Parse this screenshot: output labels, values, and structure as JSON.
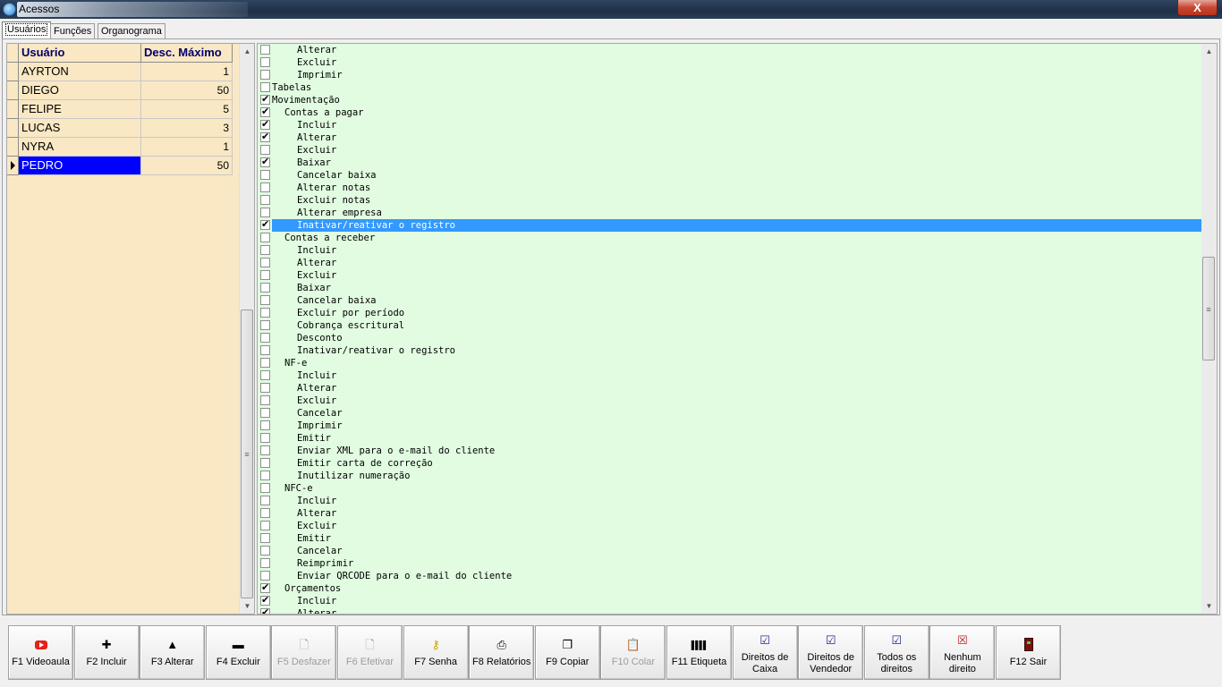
{
  "window": {
    "title": "Acessos",
    "close_glyph": "X"
  },
  "tabs": [
    {
      "label": "Usuários",
      "active": true
    },
    {
      "label": "Funções",
      "active": false
    },
    {
      "label": "Organograma",
      "active": false
    }
  ],
  "users_grid": {
    "columns": [
      "Usuário",
      "Desc. Máximo"
    ],
    "rows": [
      {
        "name": "AYRTON",
        "desc_max": "1"
      },
      {
        "name": "DIEGO",
        "desc_max": "50"
      },
      {
        "name": "FELIPE",
        "desc_max": "5"
      },
      {
        "name": "LUCAS",
        "desc_max": "3"
      },
      {
        "name": "NYRA",
        "desc_max": "1"
      },
      {
        "name": "PEDRO",
        "desc_max": "50",
        "selected": true
      }
    ]
  },
  "permissions": [
    {
      "label": "Alterar",
      "level": 2,
      "checked": false
    },
    {
      "label": "Excluir",
      "level": 2,
      "checked": false
    },
    {
      "label": "Imprimir",
      "level": 2,
      "checked": false
    },
    {
      "label": "Tabelas",
      "level": 0,
      "checked": false
    },
    {
      "label": "Movimentação",
      "level": 0,
      "checked": true
    },
    {
      "label": "Contas a pagar",
      "level": 1,
      "checked": true
    },
    {
      "label": "Incluir",
      "level": 2,
      "checked": true
    },
    {
      "label": "Alterar",
      "level": 2,
      "checked": true
    },
    {
      "label": "Excluir",
      "level": 2,
      "checked": false
    },
    {
      "label": "Baixar",
      "level": 2,
      "checked": true
    },
    {
      "label": "Cancelar baixa",
      "level": 2,
      "checked": false
    },
    {
      "label": "Alterar notas",
      "level": 2,
      "checked": false
    },
    {
      "label": "Excluir notas",
      "level": 2,
      "checked": false
    },
    {
      "label": "Alterar empresa",
      "level": 2,
      "checked": false
    },
    {
      "label": "Inativar/reativar o registro",
      "level": 2,
      "checked": true,
      "selected": true
    },
    {
      "label": "Contas a receber",
      "level": 1,
      "checked": false
    },
    {
      "label": "Incluir",
      "level": 2,
      "checked": false
    },
    {
      "label": "Alterar",
      "level": 2,
      "checked": false
    },
    {
      "label": "Excluir",
      "level": 2,
      "checked": false
    },
    {
      "label": "Baixar",
      "level": 2,
      "checked": false
    },
    {
      "label": "Cancelar baixa",
      "level": 2,
      "checked": false
    },
    {
      "label": "Excluir por período",
      "level": 2,
      "checked": false
    },
    {
      "label": "Cobrança escritural",
      "level": 2,
      "checked": false
    },
    {
      "label": "Desconto",
      "level": 2,
      "checked": false
    },
    {
      "label": "Inativar/reativar o registro",
      "level": 2,
      "checked": false
    },
    {
      "label": "NF-e",
      "level": 1,
      "checked": false
    },
    {
      "label": "Incluir",
      "level": 2,
      "checked": false
    },
    {
      "label": "Alterar",
      "level": 2,
      "checked": false
    },
    {
      "label": "Excluir",
      "level": 2,
      "checked": false
    },
    {
      "label": "Cancelar",
      "level": 2,
      "checked": false
    },
    {
      "label": "Imprimir",
      "level": 2,
      "checked": false
    },
    {
      "label": "Emitir",
      "level": 2,
      "checked": false
    },
    {
      "label": "Enviar XML para o e-mail do cliente",
      "level": 2,
      "checked": false
    },
    {
      "label": "Emitir carta de correção",
      "level": 2,
      "checked": false
    },
    {
      "label": "Inutilizar numeração",
      "level": 2,
      "checked": false
    },
    {
      "label": "NFC-e",
      "level": 1,
      "checked": false
    },
    {
      "label": "Incluir",
      "level": 2,
      "checked": false
    },
    {
      "label": "Alterar",
      "level": 2,
      "checked": false
    },
    {
      "label": "Excluir",
      "level": 2,
      "checked": false
    },
    {
      "label": "Emitir",
      "level": 2,
      "checked": false
    },
    {
      "label": "Cancelar",
      "level": 2,
      "checked": false
    },
    {
      "label": "Reimprimir",
      "level": 2,
      "checked": false
    },
    {
      "label": "Enviar QRCODE para o e-mail do cliente",
      "level": 2,
      "checked": false
    },
    {
      "label": "Orçamentos",
      "level": 1,
      "checked": true
    },
    {
      "label": "Incluir",
      "level": 2,
      "checked": true
    },
    {
      "label": "Alterar",
      "level": 2,
      "checked": true
    }
  ],
  "toolbar": [
    {
      "name": "videoaula",
      "label": "F1 Videoaula",
      "icon": "youtube-icon",
      "enabled": true
    },
    {
      "name": "incluir",
      "label": "F2 Incluir",
      "icon": "plus-icon",
      "glyph": "✚",
      "enabled": true
    },
    {
      "name": "alterar",
      "label": "F3 Alterar",
      "icon": "triangle-up-icon",
      "glyph": "▲",
      "enabled": true
    },
    {
      "name": "excluir",
      "label": "F4 Excluir",
      "icon": "minus-icon",
      "glyph": "▬",
      "enabled": true
    },
    {
      "name": "desfazer",
      "label": "F5 Desfazer",
      "icon": "page-icon",
      "glyph": "🗋",
      "enabled": false
    },
    {
      "name": "efetivar",
      "label": "F6 Efetivar",
      "icon": "page-icon",
      "glyph": "🗋",
      "enabled": false
    },
    {
      "name": "senha",
      "label": "F7 Senha",
      "icon": "key-icon",
      "glyph": "⚷",
      "enabled": true
    },
    {
      "name": "relatorios",
      "label": "F8 Relatórios",
      "icon": "printer-icon",
      "glyph": "⎙",
      "enabled": true
    },
    {
      "name": "copiar",
      "label": "F9 Copiar",
      "icon": "copy-icon",
      "glyph": "❐",
      "enabled": true
    },
    {
      "name": "colar",
      "label": "F10 Colar",
      "icon": "paste-icon",
      "glyph": "📋",
      "enabled": false
    },
    {
      "name": "etiqueta",
      "label": "F11 Etiqueta",
      "icon": "barcode-icon",
      "glyph": "▌▌▌▌",
      "enabled": true
    },
    {
      "name": "direitos-caixa",
      "label": "Direitos de Caixa",
      "icon": "doc-check-icon",
      "glyph": "☑",
      "enabled": true,
      "two_line": true
    },
    {
      "name": "direitos-vendedor",
      "label": "Direitos de Vendedor",
      "icon": "doc-check-icon",
      "glyph": "☑",
      "enabled": true,
      "two_line": true
    },
    {
      "name": "todos-direitos",
      "label": "Todos os direitos",
      "icon": "doc-check-icon",
      "glyph": "☑",
      "enabled": true,
      "two_line": true
    },
    {
      "name": "nenhum-direito",
      "label": "Nenhum direito",
      "icon": "doc-x-icon",
      "glyph": "☒",
      "enabled": true,
      "two_line": true
    },
    {
      "name": "sair",
      "label": "F12 Sair",
      "icon": "door-exit-icon",
      "enabled": true
    }
  ],
  "colors": {
    "grid_bg": "#f9e8c3",
    "tree_bg": "#e1fce1",
    "selection_blue": "#0000ff",
    "tree_selection": "#3399ff",
    "header_text": "#00006b"
  }
}
